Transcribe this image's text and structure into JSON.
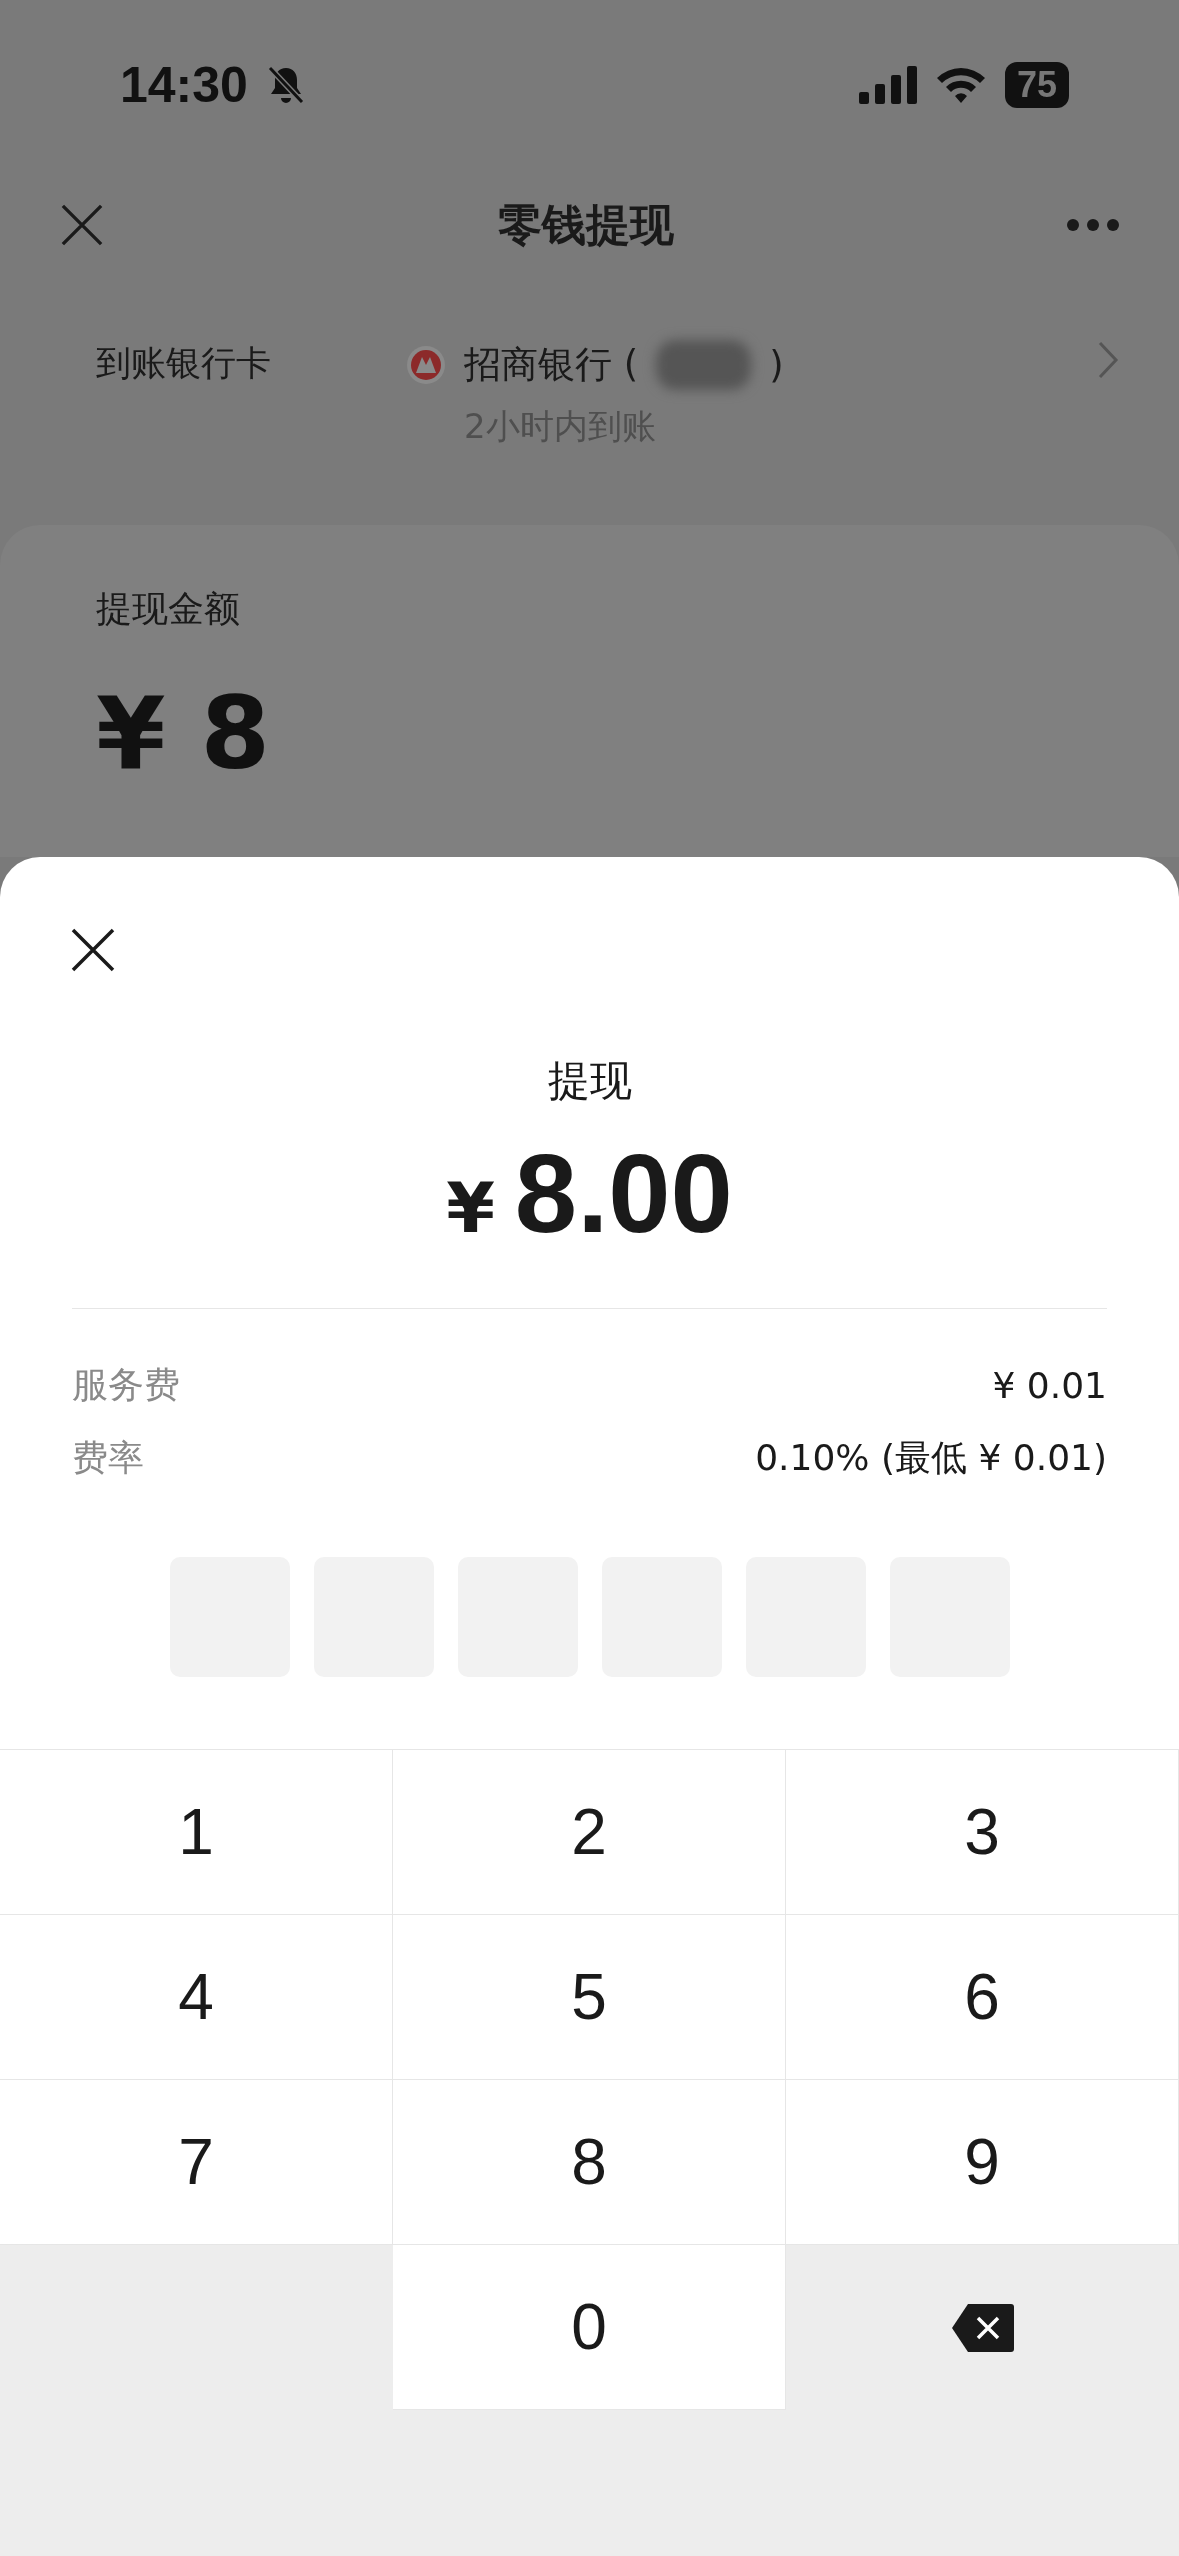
{
  "status_bar": {
    "time": "14:30",
    "battery": "75"
  },
  "nav": {
    "title": "零钱提现"
  },
  "bank": {
    "label": "到账银行卡",
    "name_open": "招商银行 (",
    "name_close": ")",
    "arrival": "2小时内到账"
  },
  "amount_card": {
    "label": "提现金额",
    "value_partial": "¥ 8"
  },
  "sheet": {
    "title": "提现",
    "currency": "¥",
    "amount": "8.00",
    "fees": [
      {
        "label": "服务费",
        "value": "¥ 0.01"
      },
      {
        "label": "费率",
        "value": "0.10% (最低 ¥ 0.01)"
      }
    ],
    "pin": [
      {
        "filled": false
      },
      {
        "filled": false
      },
      {
        "filled": false
      },
      {
        "filled": false
      },
      {
        "filled": false
      },
      {
        "filled": false
      }
    ],
    "keys": [
      {
        "kind": "digit",
        "label": "1"
      },
      {
        "kind": "digit",
        "label": "2"
      },
      {
        "kind": "digit",
        "label": "3"
      },
      {
        "kind": "digit",
        "label": "4"
      },
      {
        "kind": "digit",
        "label": "5"
      },
      {
        "kind": "digit",
        "label": "6"
      },
      {
        "kind": "digit",
        "label": "7"
      },
      {
        "kind": "digit",
        "label": "8"
      },
      {
        "kind": "digit",
        "label": "9"
      },
      {
        "kind": "blank"
      },
      {
        "kind": "digit",
        "label": "0"
      },
      {
        "kind": "backspace"
      }
    ]
  }
}
